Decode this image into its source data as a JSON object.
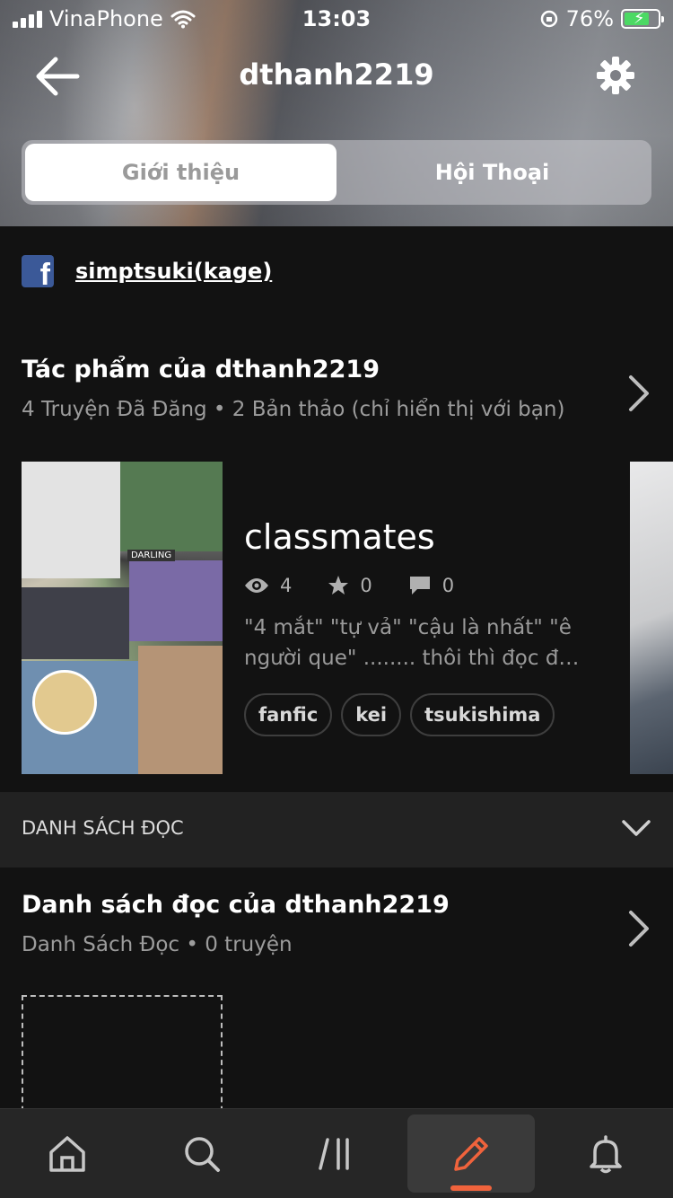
{
  "status_bar": {
    "carrier": "VinaPhone",
    "time": "13:03",
    "battery": "76%"
  },
  "header": {
    "title": "dthanh2219",
    "tabs": [
      {
        "label": "Giới thiệu",
        "active": true
      },
      {
        "label": "Hội Thoại",
        "active": false
      }
    ]
  },
  "facebook": {
    "icon": "facebook-icon",
    "username": "simptsuki(kage)"
  },
  "works": {
    "title": "Tác phẩm của dthanh2219",
    "subtitle": "4 Truyện Đã Đăng • 2 Bản thảo (chỉ hiển thị với bạn)",
    "stories": [
      {
        "title": "classmates",
        "views": "4",
        "votes": "0",
        "comments": "0",
        "description": "\"4 mắt\" \"tự vả\" \"cậu là nhất\" \"ê người que\" ........ thôi thì đọc đ…",
        "tags": [
          "fanfic",
          "kei",
          "tsukishima"
        ],
        "cover_label": "DARLING"
      }
    ]
  },
  "reading_section": {
    "label": "DANH SÁCH ĐỌC"
  },
  "reading_lists": {
    "title": "Danh sách đọc của dthanh2219",
    "subtitle": "Danh Sách Đọc • 0 truyện"
  },
  "bottom_nav": {
    "items": [
      {
        "icon": "home-icon",
        "active": false
      },
      {
        "icon": "search-icon",
        "active": false
      },
      {
        "icon": "library-icon",
        "active": false
      },
      {
        "icon": "write-icon",
        "active": true
      },
      {
        "icon": "bell-icon",
        "active": false
      }
    ],
    "accent": "#f0633c"
  }
}
